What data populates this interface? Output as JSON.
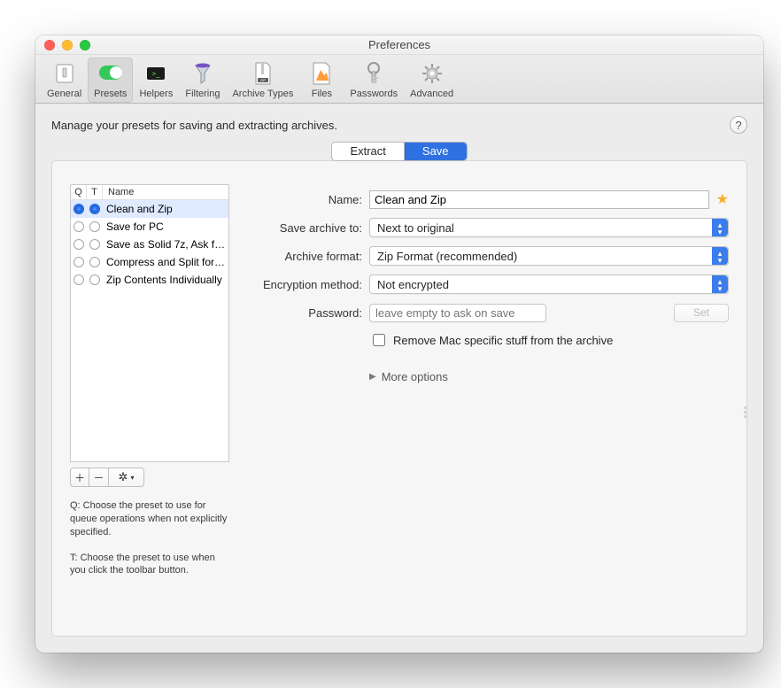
{
  "window": {
    "title": "Preferences"
  },
  "toolbar": {
    "items": [
      {
        "label": "General"
      },
      {
        "label": "Presets",
        "selected": true
      },
      {
        "label": "Helpers"
      },
      {
        "label": "Filtering"
      },
      {
        "label": "Archive Types"
      },
      {
        "label": "Files"
      },
      {
        "label": "Passwords"
      },
      {
        "label": "Advanced"
      }
    ]
  },
  "description": "Manage your presets for saving and extracting archives.",
  "help_glyph": "?",
  "segmented": {
    "extract": "Extract",
    "save": "Save"
  },
  "list": {
    "headers": {
      "q": "Q",
      "t": "T",
      "name": "Name"
    },
    "items": [
      {
        "name": "Clean and Zip",
        "q": true,
        "t": true,
        "selected": true
      },
      {
        "name": "Save for PC",
        "q": false,
        "t": false
      },
      {
        "name": "Save as Solid 7z, Ask fo…",
        "q": false,
        "t": false
      },
      {
        "name": "Compress and Split for…",
        "q": false,
        "t": false
      },
      {
        "name": "Zip Contents Individually",
        "q": false,
        "t": false
      }
    ],
    "actions": {
      "add": "+",
      "remove": "−",
      "gear": "✱"
    },
    "hint_q": "Q: Choose the preset to use for queue operations when not explicitly specified.",
    "hint_t": "T: Choose the preset to use when you click the toolbar button."
  },
  "form": {
    "name_label": "Name:",
    "name_value": "Clean and Zip",
    "star": "★",
    "save_to_label": "Save archive to:",
    "save_to_value": "Next to original",
    "format_label": "Archive format:",
    "format_value": "Zip Format (recommended)",
    "encryption_label": "Encryption method:",
    "encryption_value": "Not encrypted",
    "password_label": "Password:",
    "password_placeholder": "leave empty to ask on save",
    "set_button": "Set",
    "remove_mac_label": "Remove Mac specific stuff from the archive",
    "more_options": "More options"
  }
}
